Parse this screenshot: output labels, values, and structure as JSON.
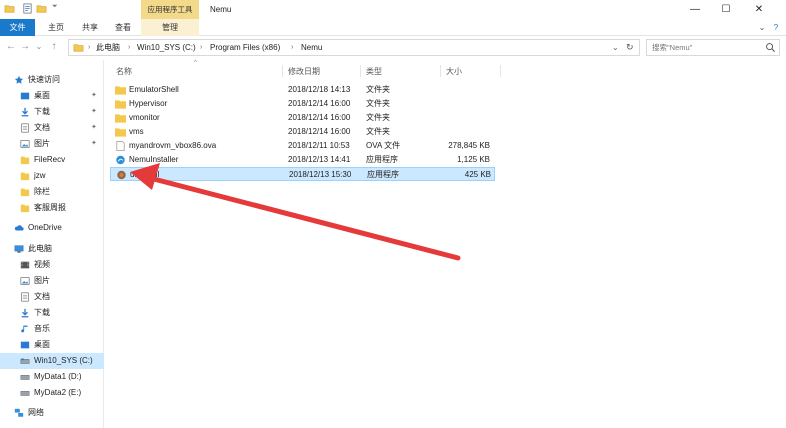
{
  "window": {
    "title": "Nemu",
    "context_tab": "应用程序工具",
    "controls": {
      "minimize": "—",
      "maximize": "☐",
      "close": "✕"
    }
  },
  "ribbon": {
    "tabs": [
      {
        "label": "文件"
      },
      {
        "label": "主页"
      },
      {
        "label": "共享"
      },
      {
        "label": "查看"
      },
      {
        "label": "管理"
      }
    ],
    "expand": "⌄",
    "help": "?"
  },
  "nav": {
    "back": "←",
    "forward": "→",
    "recent": "⌄",
    "up": "↑",
    "refresh": "↻",
    "dropdown": "⌄"
  },
  "address": {
    "crumbs": [
      "此电脑",
      "Win10_SYS (C:)",
      "Program Files (x86)",
      "Nemu"
    ],
    "sep": "›"
  },
  "search": {
    "placeholder": "搜索\"Nemu\""
  },
  "sidebar": {
    "quick_access": {
      "label": "快速访问",
      "items": [
        {
          "label": "桌面",
          "icon": "desktop-icon",
          "pinned": true
        },
        {
          "label": "下载",
          "icon": "download-icon",
          "pinned": true
        },
        {
          "label": "文档",
          "icon": "document-icon",
          "pinned": true
        },
        {
          "label": "图片",
          "icon": "picture-icon",
          "pinned": true
        },
        {
          "label": "FileRecv",
          "icon": "folder-icon",
          "pinned": false
        },
        {
          "label": "jzw",
          "icon": "folder-icon",
          "pinned": false
        },
        {
          "label": "除栏",
          "icon": "folder-icon",
          "pinned": false
        },
        {
          "label": "客服周报",
          "icon": "folder-icon",
          "pinned": false
        }
      ]
    },
    "onedrive": {
      "label": "OneDrive"
    },
    "this_pc": {
      "label": "此电脑",
      "items": [
        {
          "label": "视频",
          "icon": "video-icon"
        },
        {
          "label": "图片",
          "icon": "picture-icon"
        },
        {
          "label": "文档",
          "icon": "document-icon"
        },
        {
          "label": "下载",
          "icon": "download-icon"
        },
        {
          "label": "音乐",
          "icon": "music-icon"
        },
        {
          "label": "桌面",
          "icon": "desktop-icon"
        },
        {
          "label": "Win10_SYS (C:)",
          "icon": "drive-icon",
          "selected": true
        },
        {
          "label": "MyData1 (D:)",
          "icon": "drive-icon"
        },
        {
          "label": "MyData2 (E:)",
          "icon": "drive-icon"
        }
      ]
    },
    "network": {
      "label": "网络"
    }
  },
  "columns": {
    "name": "名称",
    "date": "修改日期",
    "type": "类型",
    "size": "大小",
    "sort_indicator": "^"
  },
  "files": [
    {
      "name": "EmulatorShell",
      "date": "2018/12/18 14:13",
      "type": "文件夹",
      "size": "",
      "icon": "folder-icon"
    },
    {
      "name": "Hypervisor",
      "date": "2018/12/14 16:00",
      "type": "文件夹",
      "size": "",
      "icon": "folder-icon"
    },
    {
      "name": "vmonitor",
      "date": "2018/12/14 16:00",
      "type": "文件夹",
      "size": "",
      "icon": "folder-icon"
    },
    {
      "name": "vms",
      "date": "2018/12/14 16:00",
      "type": "文件夹",
      "size": "",
      "icon": "folder-icon"
    },
    {
      "name": "myandrovm_vbox86.ova",
      "date": "2018/12/11 10:53",
      "type": "OVA 文件",
      "size": "278,845 KB",
      "icon": "file-icon"
    },
    {
      "name": "NemuInstaller",
      "date": "2018/12/13 14:41",
      "type": "应用程序",
      "size": "1,125 KB",
      "icon": "installer-icon"
    },
    {
      "name": "uninstall",
      "date": "2018/12/13 15:30",
      "type": "应用程序",
      "size": "425 KB",
      "icon": "uninstall-icon",
      "selected": true
    }
  ],
  "colors": {
    "accent": "#1979ca",
    "selection": "#cce8ff",
    "folder": "#f4c84e",
    "annotation_arrow": "#e43a3a"
  }
}
